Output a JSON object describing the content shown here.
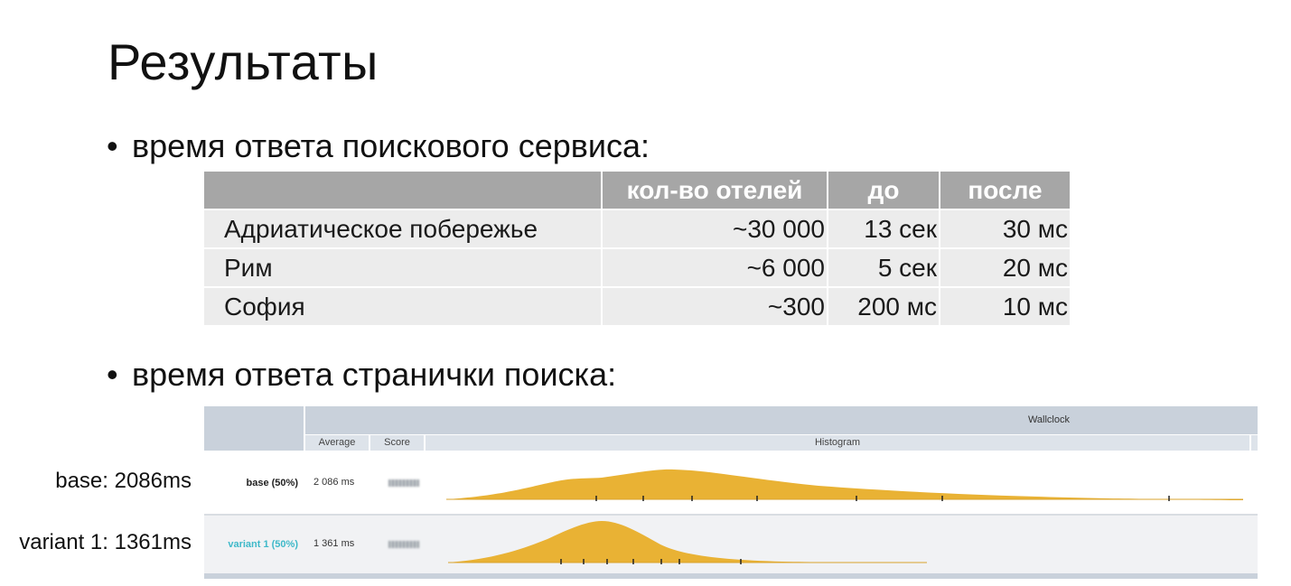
{
  "title": "Результаты",
  "bullets": {
    "service": "время ответа поискового сервиса:",
    "page": "время ответа странички поиска:"
  },
  "table": {
    "headers": [
      "",
      "кол-во отелей",
      "до",
      "после"
    ],
    "rows": [
      [
        "Адриатическое побережье",
        "~30 000",
        "13 сек",
        "30 мс"
      ],
      [
        "Рим",
        "~6 000",
        "5 сек",
        "20 мс"
      ],
      [
        "София",
        "~300",
        "200 мс",
        "10 мс"
      ]
    ]
  },
  "screenshot": {
    "group_header": "Wallclock",
    "columns": {
      "average": "Average",
      "score": "Score",
      "histogram": "Histogram"
    },
    "rows": [
      {
        "name": "base (50%)",
        "average": "2 086 ms",
        "color": "#e9b234"
      },
      {
        "name": "variant 1 (50%)",
        "average": "1 361 ms",
        "color": "#e9b234"
      }
    ],
    "accent_variant": "#3fb9c9"
  },
  "side_labels": {
    "base": "base: 2086ms",
    "variant": "variant 1: 1361ms"
  }
}
